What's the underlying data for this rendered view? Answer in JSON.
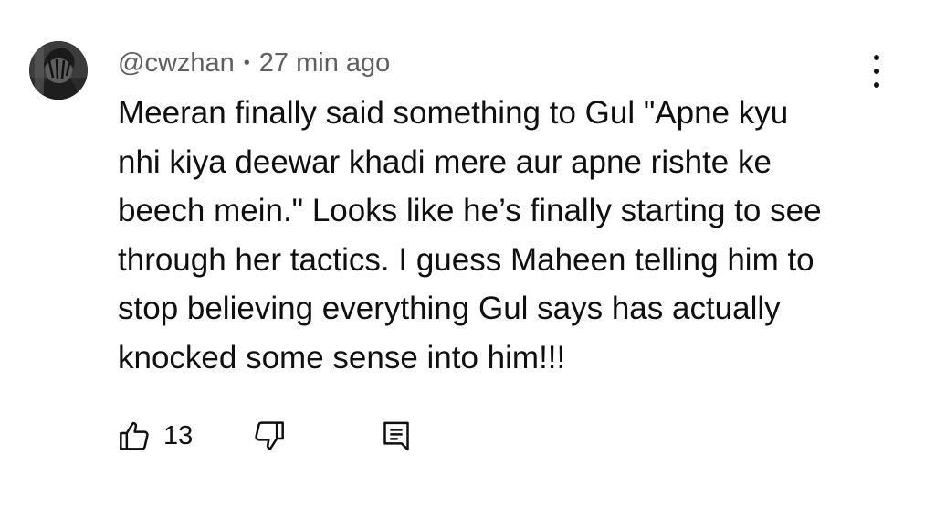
{
  "comment": {
    "author": "@cwzhan",
    "separator": "•",
    "time": "27 min ago",
    "lines": [
      "Meeran finally said something to Gul  \"Apne kyu",
      "nhi kiya deewar khadi mere aur apne rishte ke",
      "beech mein.\" Looks like he’s finally starting to see",
      "through her tactics. I guess Maheen telling him to",
      "stop believing everything Gul says has actually",
      "knocked some sense into him!!!"
    ],
    "like_count": "13"
  },
  "icons": {
    "more": "more-vertical-icon",
    "like": "thumbs-up-icon",
    "dislike": "thumbs-down-icon",
    "reply": "reply-comment-icon"
  },
  "colors": {
    "text": "#0f0f0f",
    "secondary_text": "#606060",
    "background": "#ffffff"
  }
}
